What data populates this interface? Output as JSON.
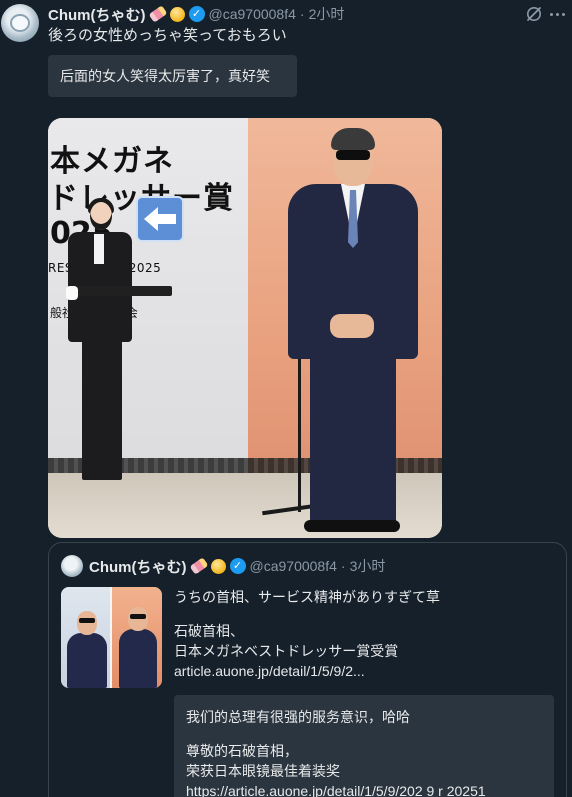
{
  "post": {
    "author_name": "Chum(ちゃむ)",
    "handle": "@ca970008f4",
    "separator": "·",
    "time": "2小时",
    "text": "後ろの女性めっちゃ笑っておもろい",
    "translation": "后面的女人笑得太厉害了，真好笑",
    "photo": {
      "banner_line1": "本メガネ",
      "banner_line2": "ドレッサー賞",
      "banner_line3": "025",
      "banner_line4": "RES    WARDS 2025",
      "banner_line5": "般社      県眼鏡協会"
    }
  },
  "quoted_post": {
    "author_name": "Chum(ちゃむ)",
    "handle": "@ca970008f4",
    "separator": "·",
    "time": "3小时",
    "text_line1": "うちの首相、サービス精神がありすぎて草",
    "text_line2": "石破首相、",
    "text_line3": "日本メガネベストドレッサー賞受賞",
    "text_line4": "article.auone.jp/detail/1/5/9/2...",
    "translation_line1": "我们的总理有很强的服务意识，哈哈",
    "translation_line2": "尊敬的石破首相，",
    "translation_line3": "荣获日本眼镜最佳着装奖",
    "translation_line4": "https://article.auone.jp/detail/1/5/9/202 9 r 20251"
  },
  "icons": {
    "verified": "verified-badge-icon",
    "grok": "grok-icon",
    "more": "more-icon",
    "arrow": "left-arrow-icon"
  },
  "colors": {
    "background": "#15202b",
    "text": "#e7e9ea",
    "secondary_text": "#8b98a5",
    "translate_box": "#2b353f",
    "verified": "#1d9bf0",
    "border": "#38444d"
  }
}
